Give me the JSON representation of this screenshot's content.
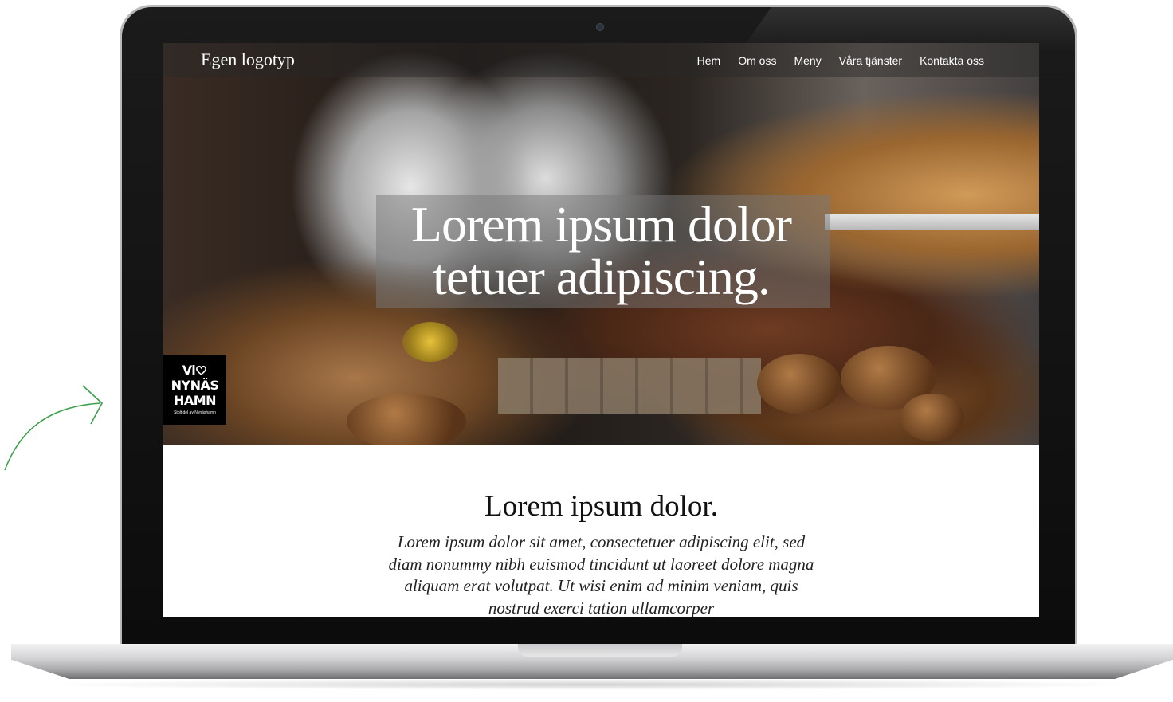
{
  "site": {
    "logo": "Egen logotyp",
    "nav": [
      "Hem",
      "Om oss",
      "Meny",
      "Våra tjänster",
      "Kontakta oss"
    ]
  },
  "hero": {
    "title": "Lorem ipsum dolor\ntetuer adipiscing."
  },
  "badge": {
    "line1": "Vi",
    "line2": "NYNÄS",
    "line3": "HAMN",
    "sub": "Stolt del av Nynäshamn"
  },
  "content": {
    "title": "Lorem ipsum dolor.",
    "body": "Lorem ipsum dolor sit amet, consectetuer adipiscing elit, sed diam nonummy nibh euismod tincidunt ut laoreet dolore magna aliquam erat volutpat. Ut wisi enim ad minim veniam, quis nostrud exerci tation ullamcorper"
  },
  "colors": {
    "arrow": "#3aa04a",
    "badge_bg": "#000000",
    "bezel": "#0f0f0f"
  },
  "icons": {
    "badge_heart": "heart-icon",
    "annotation": "curved-arrow-icon"
  }
}
